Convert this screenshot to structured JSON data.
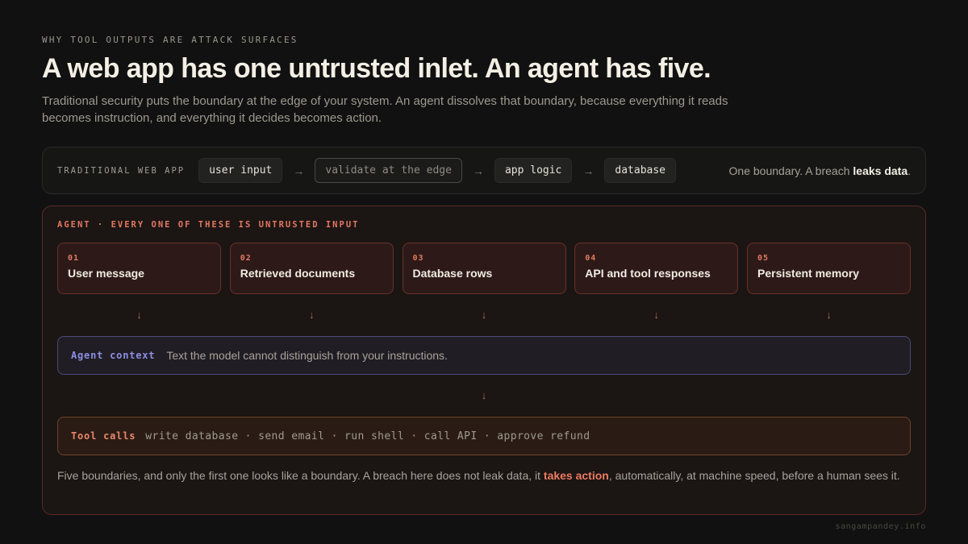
{
  "eyebrow": "WHY TOOL OUTPUTS ARE ATTACK SURFACES",
  "headline": "A web app has one untrusted inlet. An agent has five.",
  "lede": "Traditional security puts the boundary at the edge of your system. An agent dissolves that boundary, because everything it reads becomes instruction, and everything it decides becomes action.",
  "traditional": {
    "label": "TRADITIONAL WEB APP",
    "steps": [
      "user input",
      "validate at the edge",
      "app logic",
      "database"
    ],
    "arrow": "→",
    "note_prefix": "One boundary. A breach ",
    "note_emphasis": "leaks data",
    "note_suffix": "."
  },
  "agent": {
    "label": "AGENT · EVERY ONE OF THESE IS UNTRUSTED INPUT",
    "inputs": [
      {
        "num": "01",
        "title": "User message"
      },
      {
        "num": "02",
        "title": "Retrieved documents"
      },
      {
        "num": "03",
        "title": "Database rows"
      },
      {
        "num": "04",
        "title": "API and tool responses"
      },
      {
        "num": "05",
        "title": "Persistent memory"
      }
    ],
    "down_arrow": "↓",
    "context_label": "Agent context",
    "context_text": "Text the model cannot distinguish from your instructions.",
    "tools_label": "Tool calls",
    "tools_text": "write database · send email · run shell · call API · approve refund",
    "footnote_prefix": "Five boundaries, and only the first one looks like a boundary. A breach here does not leak data, it ",
    "footnote_emphasis": "takes action",
    "footnote_suffix": ", automatically, at machine speed, before a human sees it."
  },
  "credit": "sangampandey.info",
  "colors": {
    "background": "#111111",
    "accent_orange": "#e2785f",
    "context_purple": "#8b8fe4"
  }
}
